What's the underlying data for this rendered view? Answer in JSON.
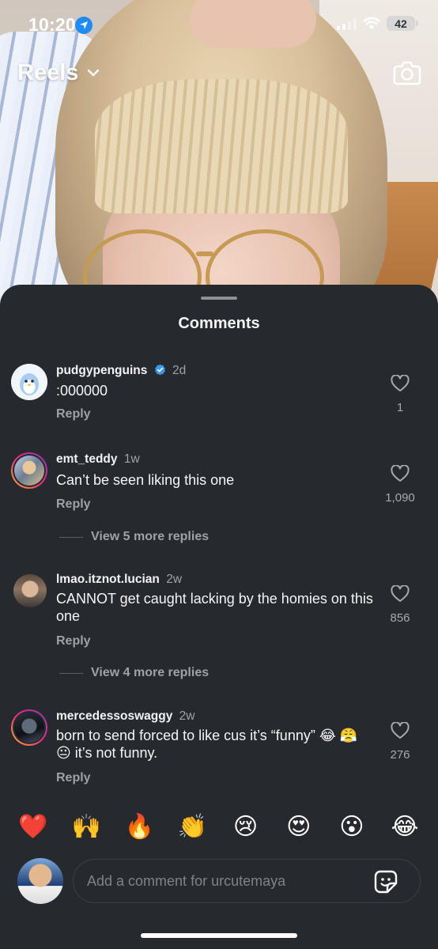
{
  "status_bar": {
    "time": "10:20",
    "battery": "42"
  },
  "header": {
    "title": "Reels"
  },
  "comments_sheet": {
    "title": "Comments",
    "comments": [
      {
        "username": "pudgypenguins",
        "verified": true,
        "age": "2d",
        "text": ":000000",
        "reply_label": "Reply",
        "likes": "1"
      },
      {
        "username": "emt_teddy",
        "verified": false,
        "age": "1w",
        "text": "Can’t be seen liking this one",
        "reply_label": "Reply",
        "likes": "1,090",
        "view_more": "View 5 more replies"
      },
      {
        "username": "lmao.itznot.lucian",
        "verified": false,
        "age": "2w",
        "text": "CANNOT get caught lacking by the homies on this one",
        "reply_label": "Reply",
        "likes": "856",
        "view_more": "View 4 more replies"
      },
      {
        "username": "mercedessoswaggy",
        "verified": false,
        "age": "2w",
        "text": "born to send forced to like cus it’s “funny” 😂 😤 😐 it’s not funny.",
        "reply_label": "Reply",
        "likes": "276"
      }
    ]
  },
  "emoji_bar": [
    "❤️",
    "🙌",
    "🔥",
    "👏",
    "😢",
    "😍",
    "😮",
    "😂"
  ],
  "composer": {
    "placeholder": "Add a comment for urcutemaya"
  },
  "icons": {
    "location": "location-arrow-icon",
    "signal": "cellular-signal-icon",
    "wifi": "wifi-icon",
    "camera": "camera-icon",
    "chevron": "chevron-down-icon",
    "heart": "heart-outline-icon",
    "sticker": "sticker-icon"
  },
  "colors": {
    "sheet_bg": "#262a2f",
    "verified_blue": "#3897f0",
    "location_blue": "#1d8cf8"
  }
}
